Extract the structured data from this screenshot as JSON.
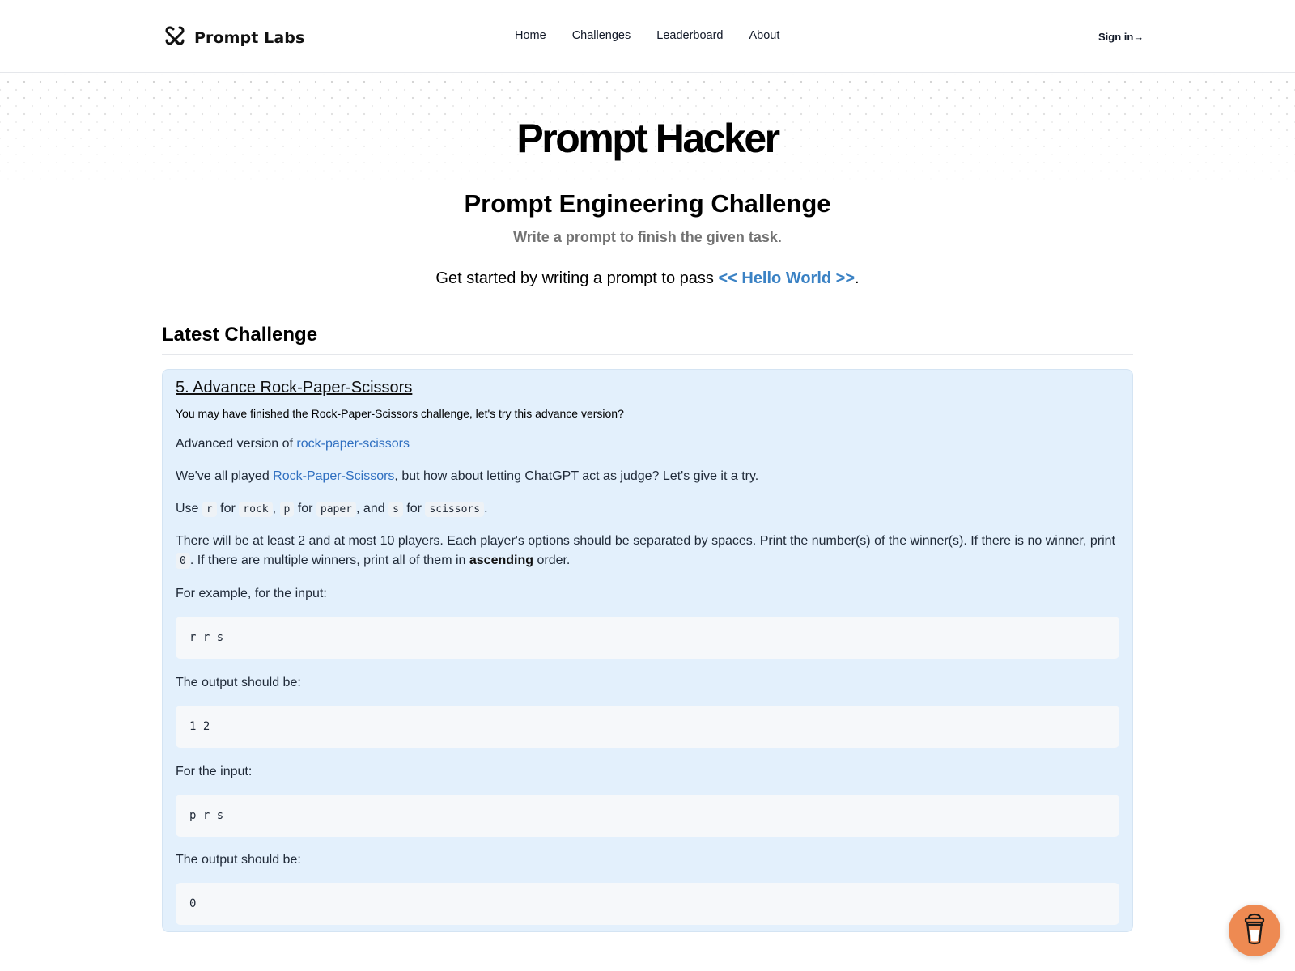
{
  "header": {
    "brand_name": "Prompt Labs",
    "brand_icon": "prompt-labs-logo-icon",
    "nav": [
      {
        "label": "Home"
      },
      {
        "label": "Challenges"
      },
      {
        "label": "Leaderboard"
      },
      {
        "label": "About"
      }
    ],
    "signin_label": "Sign in→"
  },
  "hero": {
    "title": "Prompt Hacker",
    "subtitle": "Prompt Engineering Challenge",
    "tagline": "Write a prompt to finish the given task.",
    "getstarted_prefix": "Get started by writing a prompt to pass ",
    "getstarted_link": "<< Hello World >>",
    "getstarted_suffix": "."
  },
  "latest": {
    "section_title": "Latest Challenge",
    "challenge": {
      "title": "5. Advance Rock-Paper-Scissors",
      "description": "You may have finished the Rock-Paper-Scissors challenge, let's try this advance version?",
      "advanced_prefix": "Advanced version of ",
      "advanced_link": "rock-paper-scissors",
      "played_prefix": "We've all played ",
      "played_link": "Rock-Paper-Scissors",
      "played_suffix": ", but how about letting ChatGPT act as judge? Let's give it a try.",
      "use": {
        "w_use": "Use ",
        "r": "r",
        "w_for1": " for ",
        "rock": "rock",
        "w_comma1": ", ",
        "p": "p",
        "w_for2": " for ",
        "paper": "paper",
        "w_and": ", and ",
        "s": "s",
        "w_for3": " for ",
        "scissors": "scissors",
        "w_end": "."
      },
      "rules_text1": "There will be at least 2 and at most 10 players. Each player's options should be separated by spaces. Print the number(s) of the winner(s). If there is no winner, print ",
      "rules_code": "0",
      "rules_text2": ". If there are multiple winners, print all of them in ",
      "rules_bold": "ascending",
      "rules_text3": " order.",
      "example1_label": "For example, for the input:",
      "example1_input": "r r s",
      "example1_output_label": "The output should be:",
      "example1_output": "1 2",
      "example2_label": "For the input:",
      "example2_input": "p r s",
      "example2_output_label": "The output should be:",
      "example2_output": "0"
    }
  },
  "floating": {
    "coffee_icon": "buy-me-a-coffee-icon"
  },
  "colors": {
    "link": "#3b82c4",
    "card_bg": "#e3f0fc",
    "coffee_button": "#ee8a52"
  }
}
